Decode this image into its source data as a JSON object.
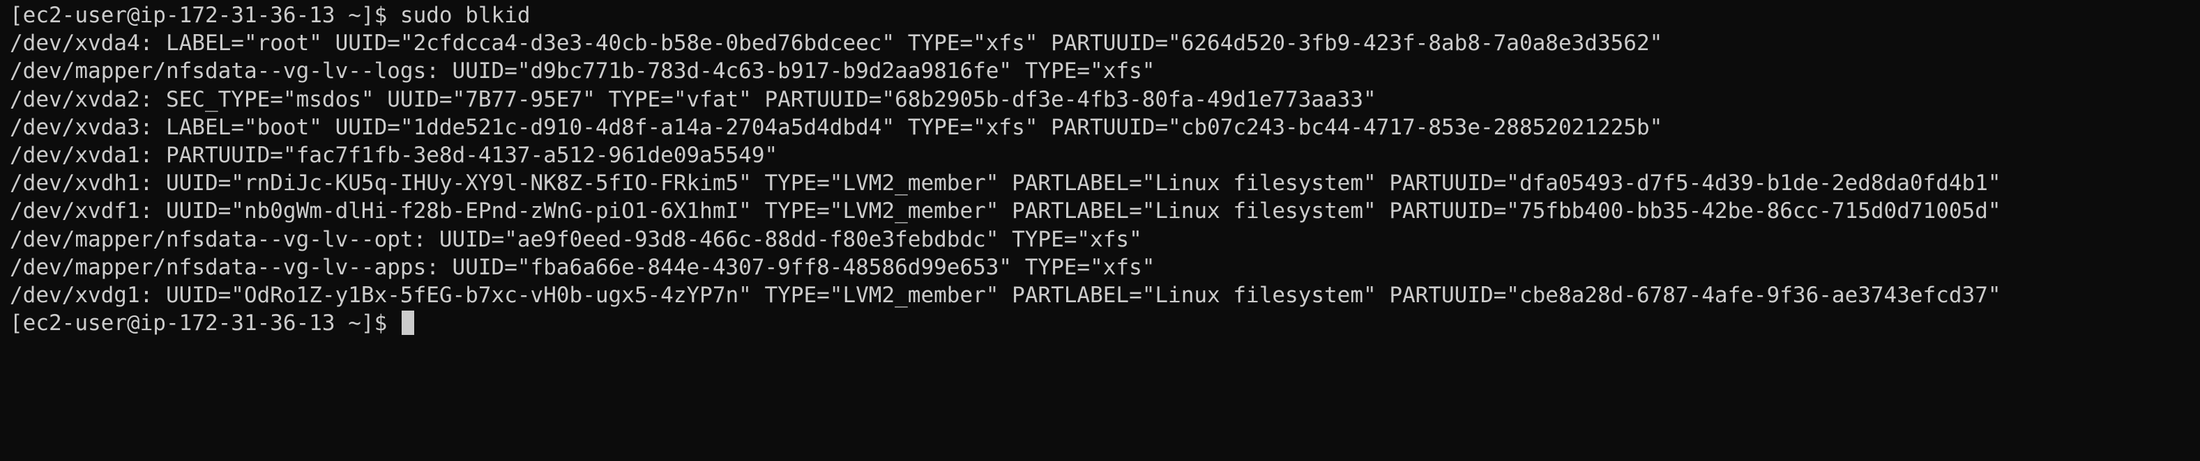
{
  "terminal": {
    "colors": {
      "background": "#0c0c0c",
      "foreground": "#cccccc"
    },
    "lines": [
      "[ec2-user@ip-172-31-36-13 ~]$ sudo blkid",
      "/dev/xvda4: LABEL=\"root\" UUID=\"2cfdcca4-d3e3-40cb-b58e-0bed76bdceec\" TYPE=\"xfs\" PARTUUID=\"6264d520-3fb9-423f-8ab8-7a0a8e3d3562\"",
      "/dev/mapper/nfsdata--vg-lv--logs: UUID=\"d9bc771b-783d-4c63-b917-b9d2aa9816fe\" TYPE=\"xfs\"",
      "/dev/xvda2: SEC_TYPE=\"msdos\" UUID=\"7B77-95E7\" TYPE=\"vfat\" PARTUUID=\"68b2905b-df3e-4fb3-80fa-49d1e773aa33\"",
      "/dev/xvda3: LABEL=\"boot\" UUID=\"1dde521c-d910-4d8f-a14a-2704a5d4dbd4\" TYPE=\"xfs\" PARTUUID=\"cb07c243-bc44-4717-853e-28852021225b\"",
      "/dev/xvda1: PARTUUID=\"fac7f1fb-3e8d-4137-a512-961de09a5549\"",
      "/dev/xvdh1: UUID=\"rnDiJc-KU5q-IHUy-XY9l-NK8Z-5fIO-FRkim5\" TYPE=\"LVM2_member\" PARTLABEL=\"Linux filesystem\" PARTUUID=\"dfa05493-d7f5-4d39-b1de-2ed8da0fd4b1\"",
      "/dev/xvdf1: UUID=\"nb0gWm-dlHi-f28b-EPnd-zWnG-piO1-6X1hmI\" TYPE=\"LVM2_member\" PARTLABEL=\"Linux filesystem\" PARTUUID=\"75fbb400-bb35-42be-86cc-715d0d71005d\"",
      "/dev/mapper/nfsdata--vg-lv--opt: UUID=\"ae9f0eed-93d8-466c-88dd-f80e3febdbdc\" TYPE=\"xfs\"",
      "/dev/mapper/nfsdata--vg-lv--apps: UUID=\"fba6a66e-844e-4307-9ff8-48586d99e653\" TYPE=\"xfs\"",
      "/dev/xvdg1: UUID=\"OdRo1Z-y1Bx-5fEG-b7xc-vH0b-ugx5-4zYP7n\" TYPE=\"LVM2_member\" PARTLABEL=\"Linux filesystem\" PARTUUID=\"cbe8a28d-6787-4afe-9f36-ae3743efcd37\""
    ],
    "prompt": "[ec2-user@ip-172-31-36-13 ~]$ "
  }
}
